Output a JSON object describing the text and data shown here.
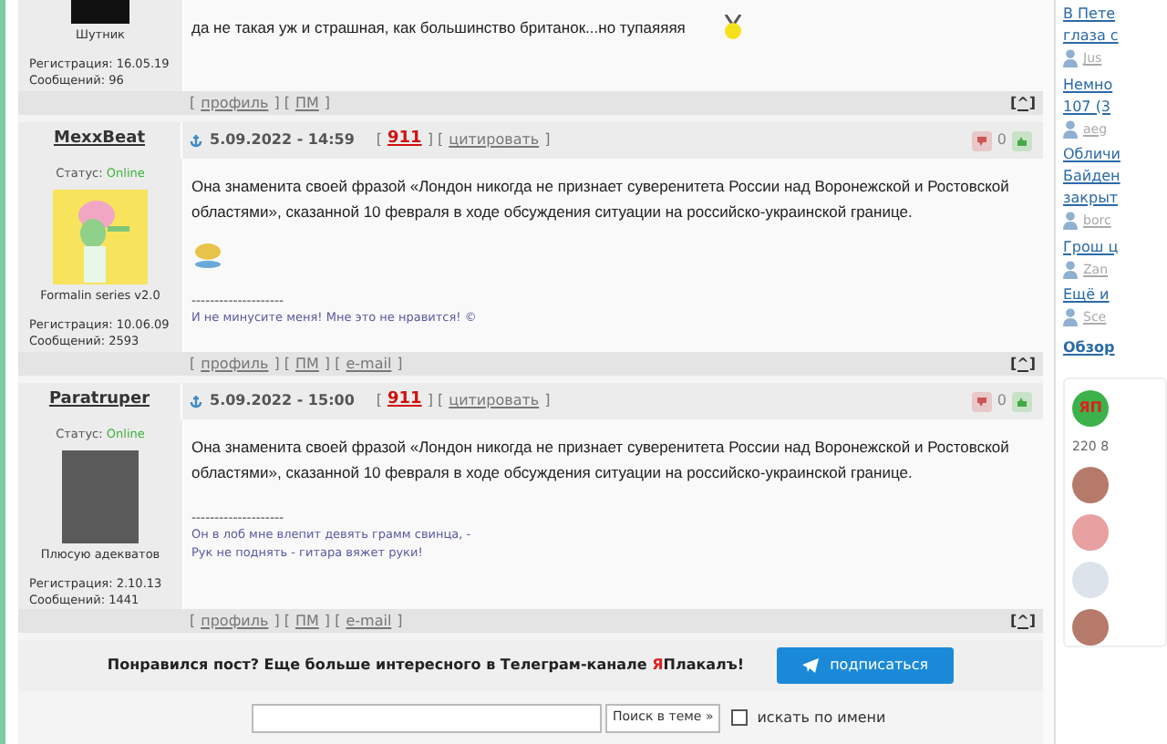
{
  "posts": [
    {
      "avatar": {
        "kind": "dark"
      },
      "avatar_caption": "Шутник",
      "registration": "Регистрация: 16.05.19",
      "messages": "Сообщений: 96",
      "text": "да не такая уж и страшная, как большинство британок...но тупаяяяя",
      "smiley": {
        "kind": "medal"
      },
      "footer": [
        {
          "kind": "text",
          "text": "["
        },
        {
          "kind": "link",
          "text": "профиль"
        },
        {
          "kind": "text",
          "text": "] ["
        },
        {
          "kind": "link",
          "text": "ПМ"
        },
        {
          "kind": "text",
          "text": "]"
        }
      ],
      "top_link": "[^]"
    },
    {
      "author": "MexxBeat",
      "status_label": "Статус:",
      "status": "Online",
      "avatar": {
        "kind": "cartoon"
      },
      "avatar_caption": "Formalin series v2.0",
      "registration": "Регистрация: 10.06.09",
      "messages": "Сообщений: 2593",
      "date": "5.09.2022 - 14:59",
      "header": [
        {
          "kind": "text",
          "text": "["
        },
        {
          "kind": "rating",
          "text": "911"
        },
        {
          "kind": "text",
          "text": "] ["
        },
        {
          "kind": "link",
          "text": "цитировать"
        },
        {
          "kind": "text",
          "text": "]"
        }
      ],
      "vote": "0",
      "text": "Она знаменита своей фразой «Лондон никогда не признает суверенитета России над Воронежской и Ростовской областями», сказанной 10 февраля в ходе обсуждения ситуации на российско-украинской границе.",
      "smiley": {
        "kind": "cup"
      },
      "signature": [
        "--------------------",
        "И не минусите меня! Мне это не нравится! ©"
      ],
      "footer": [
        {
          "kind": "text",
          "text": "["
        },
        {
          "kind": "link",
          "text": "профиль"
        },
        {
          "kind": "text",
          "text": "] ["
        },
        {
          "kind": "link",
          "text": "ПМ"
        },
        {
          "kind": "text",
          "text": "] ["
        },
        {
          "kind": "link",
          "text": "e-mail"
        },
        {
          "kind": "text",
          "text": "]"
        }
      ],
      "top_link": "[^]"
    },
    {
      "author": "Paratruper",
      "status_label": "Статус:",
      "status": "Online",
      "avatar": {
        "kind": "photo"
      },
      "avatar_caption": "Плюсую адекватов",
      "registration": "Регистрация: 2.10.13",
      "messages": "Сообщений: 1441",
      "date": "5.09.2022 - 15:00",
      "header": [
        {
          "kind": "text",
          "text": "["
        },
        {
          "kind": "rating",
          "text": "911"
        },
        {
          "kind": "text",
          "text": "] ["
        },
        {
          "kind": "link",
          "text": "цитировать"
        },
        {
          "kind": "text",
          "text": "]"
        }
      ],
      "vote": "0",
      "text": "Она знаменита своей фразой «Лондон никогда не признает суверенитета России над Воронежской и Ростовской областями», сказанной 10 февраля в ходе обсуждения ситуации на российско-украинской границе.",
      "signature": [
        "--------------------",
        "Он в лоб мне влепит девять грамм свинца, -",
        "Рук не поднять - гитара вяжет руки!"
      ],
      "footer": [
        {
          "kind": "text",
          "text": "["
        },
        {
          "kind": "link",
          "text": "профиль"
        },
        {
          "kind": "text",
          "text": "] ["
        },
        {
          "kind": "link",
          "text": "ПМ"
        },
        {
          "kind": "text",
          "text": "] ["
        },
        {
          "kind": "link",
          "text": "e-mail"
        },
        {
          "kind": "text",
          "text": "]"
        }
      ],
      "top_link": "[^]"
    }
  ],
  "telegram": {
    "text": "Понравился пост? Еще больше интересного в Телеграм-канале ",
    "brand_accent": "Я",
    "brand_rest": "Плакалъ!",
    "button": "подписаться"
  },
  "search": {
    "button": "Поиск в теме »",
    "checkbox": {
      "label": "искать по имени",
      "checked": false
    }
  },
  "sidebar": {
    "topics": [
      {
        "title_lines": [
          "В Пете",
          "глаза с"
        ],
        "author": "Jus"
      },
      {
        "title_lines": [
          "Немно",
          "107 (3"
        ],
        "author": "aeg"
      },
      {
        "title_lines": [
          "Обличи",
          "Байден",
          "закрыт"
        ],
        "author": "borc"
      },
      {
        "title_lines": [
          "Грош ц"
        ],
        "author": "Zan"
      },
      {
        "title_lines": [
          "Ещё и"
        ],
        "author": "Sce"
      }
    ],
    "overview": "Обзор",
    "card": {
      "logo": "ЯП",
      "count": "220 8",
      "avatars": [
        {
          "kind": "face"
        },
        {
          "kind": "cartoon"
        },
        {
          "kind": "camera"
        },
        {
          "kind": "face"
        }
      ]
    }
  }
}
